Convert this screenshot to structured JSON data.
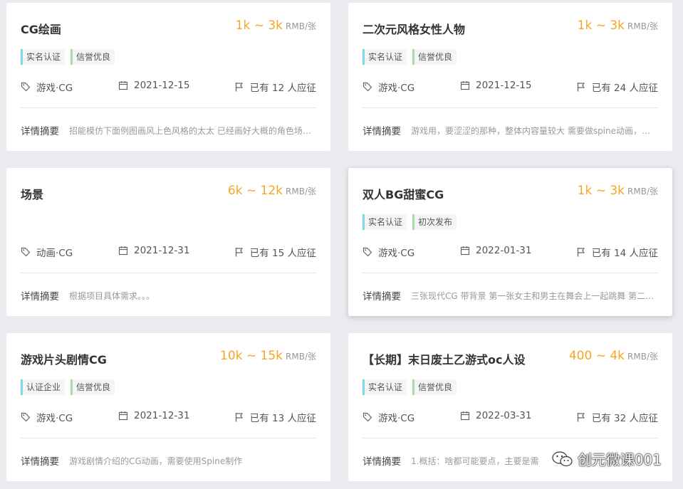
{
  "cards": [
    {
      "title": "CG绘画",
      "price": "1k ~ 3k",
      "unit": "RMB/张",
      "tags": [
        "实名认证",
        "信誉优良"
      ],
      "category": "游戏·CG",
      "date": "2021-12-15",
      "applicants": "已有 12 人应征",
      "summary_label": "详情摘要",
      "summary": "招能模仿下面例图画风上色风格的太太 已经画好大概的角色场景线稿 需要上色"
    },
    {
      "title": "二次元风格女性人物",
      "price": "1k ~ 3k",
      "unit": "RMB/张",
      "tags": [
        "实名认证",
        "信誉优良"
      ],
      "category": "游戏·CG",
      "date": "2021-12-15",
      "applicants": "已有 24 人应征",
      "summary_label": "详情摘要",
      "summary": "游戏用，要涩涩的那种，整体内容量较大 需要做spine动画，需要拆分"
    },
    {
      "title": "场景",
      "price": "6k ~ 12k",
      "unit": "RMB/张",
      "tags": [],
      "category": "动画·CG",
      "date": "2021-12-31",
      "applicants": "已有 15 人应征",
      "summary_label": "详情摘要",
      "summary": "根据项目具体需求。。。"
    },
    {
      "title": "双人BG甜蜜CG",
      "price": "1k ~ 3k",
      "unit": "RMB/张",
      "tags": [
        "实名认证",
        "初次发布"
      ],
      "category": "游戏·CG",
      "date": "2022-01-31",
      "applicants": "已有 14 人应征",
      "summary_label": "详情摘要",
      "summary": "三张现代CG 带背景 第一张女主和男主在舞会上一起跳舞 第二张在海边散步"
    },
    {
      "title": "游戏片头剧情CG",
      "price": "10k ~ 15k",
      "unit": "RMB/张",
      "tags": [
        "认证企业",
        "信誉优良"
      ],
      "category": "游戏·CG",
      "date": "2021-12-31",
      "applicants": "已有 13 人应征",
      "summary_label": "详情摘要",
      "summary": "游戏剧情介绍的CG动画，需要使用Spine制作"
    },
    {
      "title": "【长期】末日废土乙游式oc人设",
      "price": "400 ~ 4k",
      "unit": "RMB/张",
      "tags": [
        "实名认证",
        "信誉优良"
      ],
      "category": "游戏·CG",
      "date": "2022-03-31",
      "applicants": "已有 32 人应征",
      "summary_label": "详情摘要",
      "summary": "1.概括：啥都可能要点，主要是需"
    }
  ],
  "watermark": "创元微课001",
  "colors": {
    "price": "#f5a623",
    "tag_blue": "#7ed9e6",
    "tag_green": "#a9df9e"
  }
}
